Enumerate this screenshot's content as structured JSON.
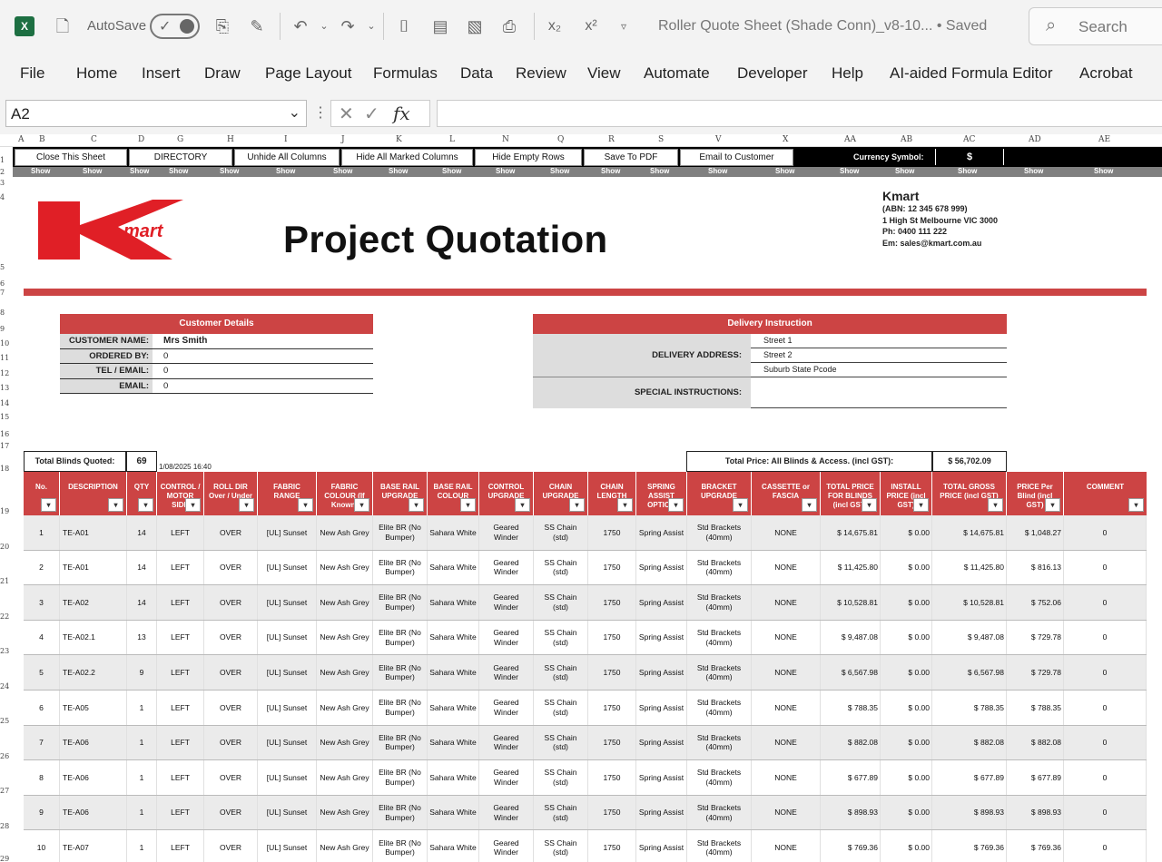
{
  "titlebar": {
    "app_icon": "excel-icon",
    "autosave_label": "AutoSave",
    "doc_title": "Roller Quote Sheet (Shade Conn)_v8-10...  •  Saved",
    "search_placeholder": "Search"
  },
  "menu": [
    "File",
    "Home",
    "Insert",
    "Draw",
    "Page Layout",
    "Formulas",
    "Data",
    "Review",
    "View",
    "Automate",
    "Developer",
    "Help",
    "AI-aided Formula Editor",
    "Acrobat"
  ],
  "formula_bar": {
    "name_box": "A2",
    "fx": "fx"
  },
  "column_letters": [
    "A",
    "B",
    "C",
    "D",
    "G",
    "H",
    "I",
    "J",
    "K",
    "L",
    "N",
    "Q",
    "R",
    "S",
    "V",
    "X",
    "AA",
    "AB",
    "AC",
    "AD",
    "AE"
  ],
  "row_numbers": [
    "1",
    "2",
    "3",
    "4",
    "5",
    "6",
    "7",
    "8",
    "9",
    "10",
    "11",
    "12",
    "13",
    "14",
    "15",
    "16",
    "17",
    "18",
    "19",
    "20",
    "21",
    "22",
    "23",
    "24",
    "25",
    "26",
    "27",
    "28",
    "29"
  ],
  "buttons": [
    "Close This Sheet",
    "DIRECTORY",
    "Unhide All Columns",
    "Hide All Marked Columns",
    "Hide Empty Rows",
    "Save To PDF",
    "Email to Customer"
  ],
  "currency": {
    "label": "Currency Symbol:",
    "value": "$"
  },
  "show_label": "Show",
  "header": {
    "title": "Project Quotation",
    "company_name": "Kmart",
    "company_lines": [
      "(ABN: 12 345 678 999)",
      "1 High St  Melbourne  VIC  3000",
      "Ph:  0400 111 222",
      "Em:  sales@kmart.com.au"
    ],
    "logo_text": "mart"
  },
  "customer": {
    "heading": "Customer Details",
    "rows": [
      {
        "label": "CUSTOMER NAME:",
        "value": "Mrs Smith"
      },
      {
        "label": "ORDERED BY:",
        "value": "0"
      },
      {
        "label": "TEL / EMAIL:",
        "value": "0"
      },
      {
        "label": "EMAIL:",
        "value": "0"
      }
    ]
  },
  "delivery": {
    "heading": "Delivery Instruction",
    "address_label": "DELIVERY ADDRESS:",
    "address_lines": [
      "Street 1",
      "Street 2",
      "Suburb   State   Pcode"
    ],
    "special_label": "SPECIAL INSTRUCTIONS:"
  },
  "totals": {
    "blinds_label": "Total Blinds Quoted:",
    "blinds_value": "69",
    "date": "1/08/2025 16:40",
    "price_label": "Total Price:  All Blinds & Access. (incl GST):",
    "price_value": "$ 56,702.09"
  },
  "table": {
    "headers": [
      "No.",
      "DESCRIPTION",
      "QTY",
      "CONTROL / MOTOR SIDE",
      "ROLL DIR Over / Under",
      "FABRIC RANGE",
      "FABRIC COLOUR (If Known)",
      "BASE RAIL UPGRADE",
      "BASE RAIL COLOUR",
      "CONTROL UPGRADE",
      "CHAIN UPGRADE",
      "CHAIN LENGTH",
      "SPRING ASSIST OPTION",
      "BRACKET UPGRADE",
      "CASSETTE or FASCIA",
      "TOTAL PRICE FOR BLINDS (incl GST)",
      "INSTALL PRICE (incl GST)",
      "TOTAL GROSS PRICE (incl GST)",
      "PRICE Per Blind (incl GST)",
      "COMMENT"
    ],
    "rows": [
      [
        "1",
        "TE-A01",
        "14",
        "LEFT",
        "OVER",
        "[UL] Sunset",
        "New Ash Grey",
        "Elite BR (No Bumper)",
        "Sahara White",
        "Geared Winder",
        "SS Chain (std)",
        "1750",
        "Spring Assist",
        "Std Brackets (40mm)",
        "NONE",
        "$ 14,675.81",
        "$ 0.00",
        "$ 14,675.81",
        "$ 1,048.27",
        "0"
      ],
      [
        "2",
        "TE-A01",
        "14",
        "LEFT",
        "OVER",
        "[UL] Sunset",
        "New Ash Grey",
        "Elite BR (No Bumper)",
        "Sahara White",
        "Geared Winder",
        "SS Chain (std)",
        "1750",
        "Spring Assist",
        "Std Brackets (40mm)",
        "NONE",
        "$ 11,425.80",
        "$ 0.00",
        "$ 11,425.80",
        "$ 816.13",
        "0"
      ],
      [
        "3",
        "TE-A02",
        "14",
        "LEFT",
        "OVER",
        "[UL] Sunset",
        "New Ash Grey",
        "Elite BR (No Bumper)",
        "Sahara White",
        "Geared Winder",
        "SS Chain (std)",
        "1750",
        "Spring Assist",
        "Std Brackets (40mm)",
        "NONE",
        "$ 10,528.81",
        "$ 0.00",
        "$ 10,528.81",
        "$ 752.06",
        "0"
      ],
      [
        "4",
        "TE-A02.1",
        "13",
        "LEFT",
        "OVER",
        "[UL] Sunset",
        "New Ash Grey",
        "Elite BR (No Bumper)",
        "Sahara White",
        "Geared Winder",
        "SS Chain (std)",
        "1750",
        "Spring Assist",
        "Std Brackets (40mm)",
        "NONE",
        "$ 9,487.08",
        "$ 0.00",
        "$ 9,487.08",
        "$ 729.78",
        "0"
      ],
      [
        "5",
        "TE-A02.2",
        "9",
        "LEFT",
        "OVER",
        "[UL] Sunset",
        "New Ash Grey",
        "Elite BR (No Bumper)",
        "Sahara White",
        "Geared Winder",
        "SS Chain (std)",
        "1750",
        "Spring Assist",
        "Std Brackets (40mm)",
        "NONE",
        "$ 6,567.98",
        "$ 0.00",
        "$ 6,567.98",
        "$ 729.78",
        "0"
      ],
      [
        "6",
        "TE-A05",
        "1",
        "LEFT",
        "OVER",
        "[UL] Sunset",
        "New Ash Grey",
        "Elite BR (No Bumper)",
        "Sahara White",
        "Geared Winder",
        "SS Chain (std)",
        "1750",
        "Spring Assist",
        "Std Brackets (40mm)",
        "NONE",
        "$ 788.35",
        "$ 0.00",
        "$ 788.35",
        "$ 788.35",
        "0"
      ],
      [
        "7",
        "TE-A06",
        "1",
        "LEFT",
        "OVER",
        "[UL] Sunset",
        "New Ash Grey",
        "Elite BR (No Bumper)",
        "Sahara White",
        "Geared Winder",
        "SS Chain (std)",
        "1750",
        "Spring Assist",
        "Std Brackets (40mm)",
        "NONE",
        "$ 882.08",
        "$ 0.00",
        "$ 882.08",
        "$ 882.08",
        "0"
      ],
      [
        "8",
        "TE-A06",
        "1",
        "LEFT",
        "OVER",
        "[UL] Sunset",
        "New Ash Grey",
        "Elite BR (No Bumper)",
        "Sahara White",
        "Geared Winder",
        "SS Chain (std)",
        "1750",
        "Spring Assist",
        "Std Brackets (40mm)",
        "NONE",
        "$ 677.89",
        "$ 0.00",
        "$ 677.89",
        "$ 677.89",
        "0"
      ],
      [
        "9",
        "TE-A06",
        "1",
        "LEFT",
        "OVER",
        "[UL] Sunset",
        "New Ash Grey",
        "Elite BR (No Bumper)",
        "Sahara White",
        "Geared Winder",
        "SS Chain (std)",
        "1750",
        "Spring Assist",
        "Std Brackets (40mm)",
        "NONE",
        "$ 898.93",
        "$ 0.00",
        "$ 898.93",
        "$ 898.93",
        "0"
      ],
      [
        "10",
        "TE-A07",
        "1",
        "LEFT",
        "OVER",
        "[UL] Sunset",
        "New Ash Grey",
        "Elite BR (No Bumper)",
        "Sahara White",
        "Geared Winder",
        "SS Chain (std)",
        "1750",
        "Spring Assist",
        "Std Brackets (40mm)",
        "NONE",
        "$ 769.36",
        "$ 0.00",
        "$ 769.36",
        "$ 769.36",
        "0"
      ]
    ]
  },
  "colors": {
    "accent_red": "#cc4444",
    "excel_green": "#1d6f42",
    "row_grey": "#ebebeb"
  }
}
